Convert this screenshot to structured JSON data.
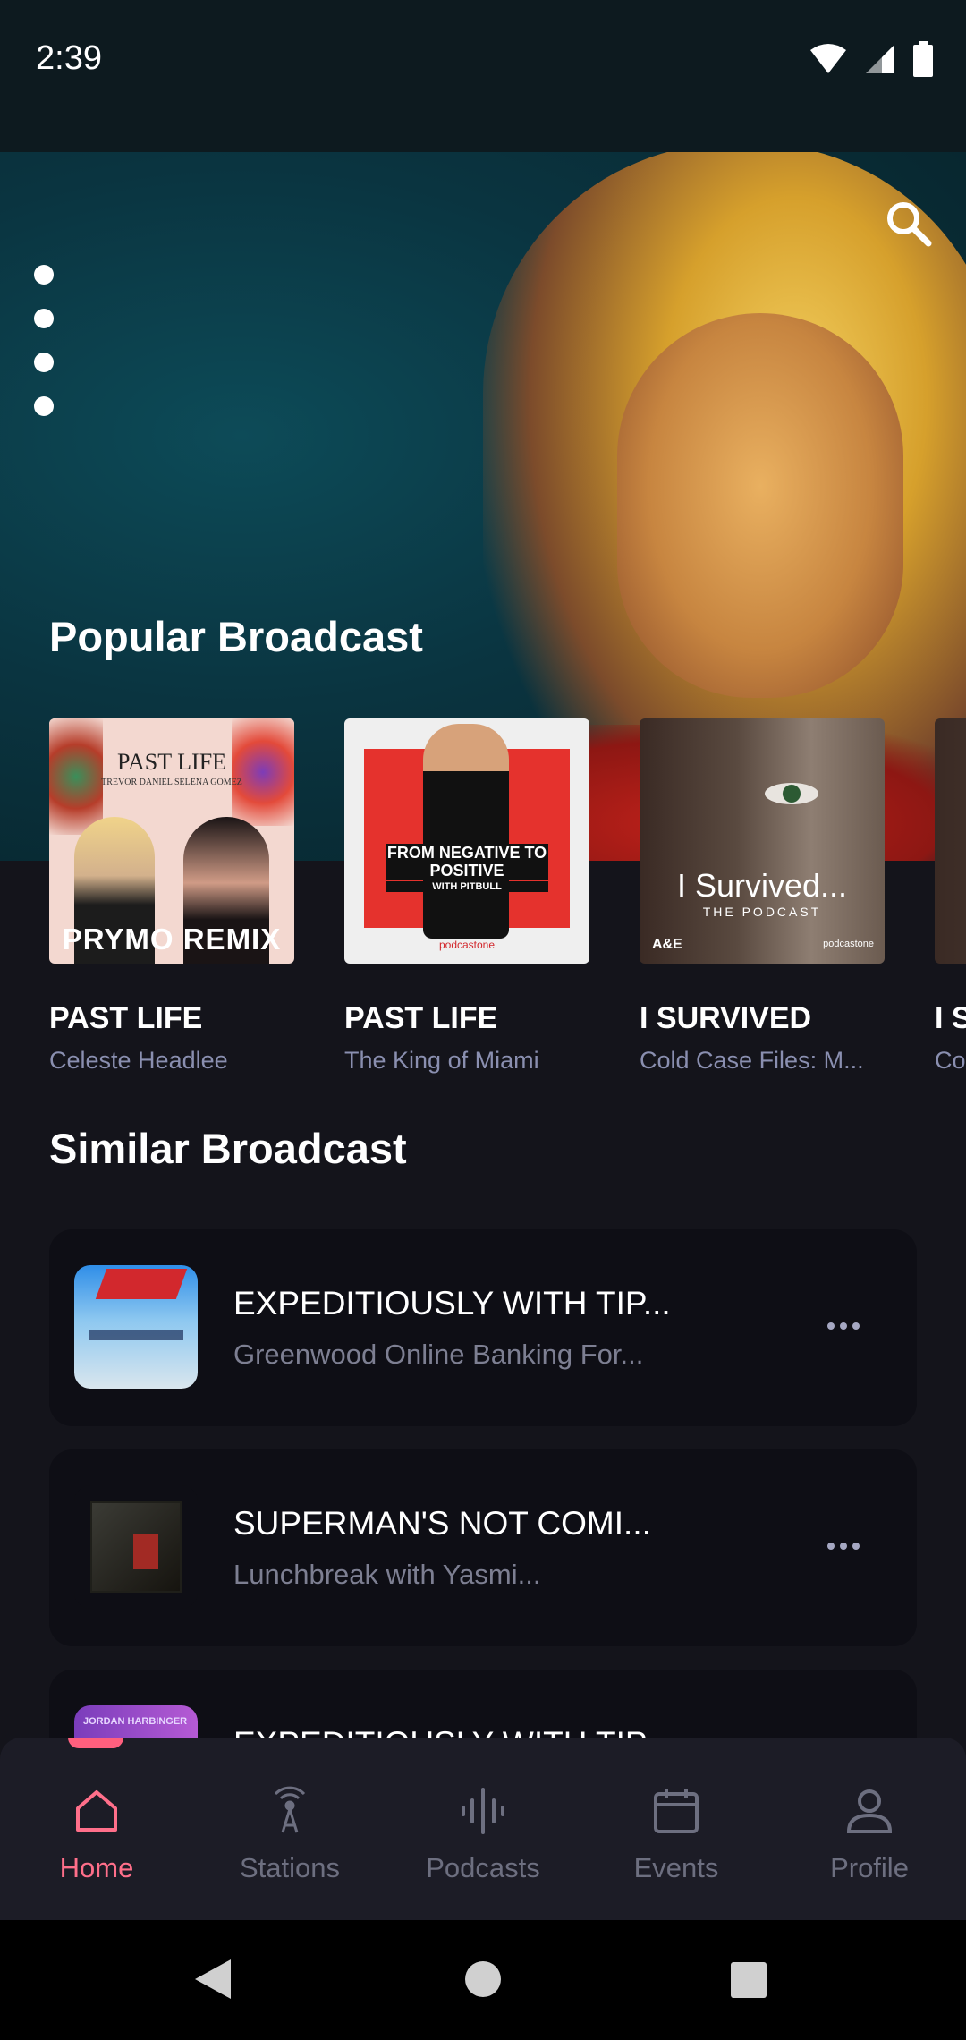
{
  "status_bar": {
    "time": "2:39"
  },
  "popular": {
    "title": "Popular Broadcast",
    "items": [
      {
        "title": "PAST LIFE",
        "subtitle": "Celeste Headlee",
        "art_top": "PAST LIFE",
        "art_names": "TREVOR DANIEL   SELENA GOMEZ",
        "art_bottom": "PRYMO REMIX"
      },
      {
        "title": "PAST LIFE",
        "subtitle": "The King of Miami",
        "art_text": "FROM NEGATIVE TO POSITIVE",
        "art_with": "WITH PITBULL",
        "art_brand": "podcastone"
      },
      {
        "title": "I SURVIVED",
        "subtitle": "Cold Case Files: M...",
        "art_text": "I Survived...",
        "art_sub": "THE PODCAST",
        "art_brand": "podcastone",
        "art_logo": "A&E"
      },
      {
        "title": "I S",
        "subtitle": "Co"
      }
    ]
  },
  "similar": {
    "title": "Similar Broadcast",
    "items": [
      {
        "title": "EXPEDITIOUSLY WITH TIP...",
        "subtitle": "Greenwood Online Banking For..."
      },
      {
        "title": "SUPERMAN'S NOT COMI...",
        "subtitle": "Lunchbreak with Yasmi..."
      },
      {
        "title": "EXPEDITIOUSLY WITH TIP",
        "subtitle": "",
        "thumb_text": "JORDAN HARBINGER"
      }
    ]
  },
  "nav": {
    "items": [
      {
        "label": "Home",
        "icon": "home-icon",
        "active": true
      },
      {
        "label": "Stations",
        "icon": "broadcast-icon"
      },
      {
        "label": "Podcasts",
        "icon": "waveform-icon"
      },
      {
        "label": "Events",
        "icon": "calendar-icon"
      },
      {
        "label": "Profile",
        "icon": "person-icon"
      }
    ]
  },
  "colors": {
    "accent": "#ff6f8a",
    "background": "#14141b",
    "card": "#0e0e15",
    "nav": "#1c1c26"
  }
}
